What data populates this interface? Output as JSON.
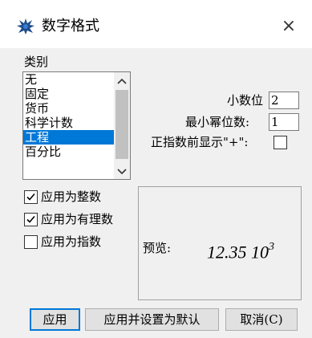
{
  "window": {
    "title": "数字格式",
    "close_symbol": "×"
  },
  "category": {
    "label": "类别",
    "items": [
      "无",
      "固定",
      "货币",
      "科学计数",
      "工程",
      "百分比"
    ],
    "selected": "工程"
  },
  "fields": {
    "decimals_label": "小数位",
    "decimals_value": "2",
    "min_exp_digits_label": "最小幂位数:",
    "min_exp_digits_value": "1",
    "show_plus_label": "正指数前显示\"+\":"
  },
  "options": {
    "as_integer_label": "应用为整数",
    "as_integer_checked": true,
    "as_rational_label": "应用为有理数",
    "as_rational_checked": true,
    "as_exponent_label": "应用为指数",
    "as_exponent_checked": false,
    "show_plus_checked": false
  },
  "preview": {
    "label": "预览:",
    "mantissa": "12.35 10",
    "exponent": "3"
  },
  "buttons": {
    "apply": "应用",
    "apply_default": "应用并设置为默认",
    "cancel": "取消(C)"
  },
  "colors": {
    "selection": "#0078d7",
    "dialog_bg": "#f0f0f0"
  },
  "icons": {
    "app": "app-logo-icon",
    "close": "close-icon",
    "check": "checkmark-icon"
  }
}
